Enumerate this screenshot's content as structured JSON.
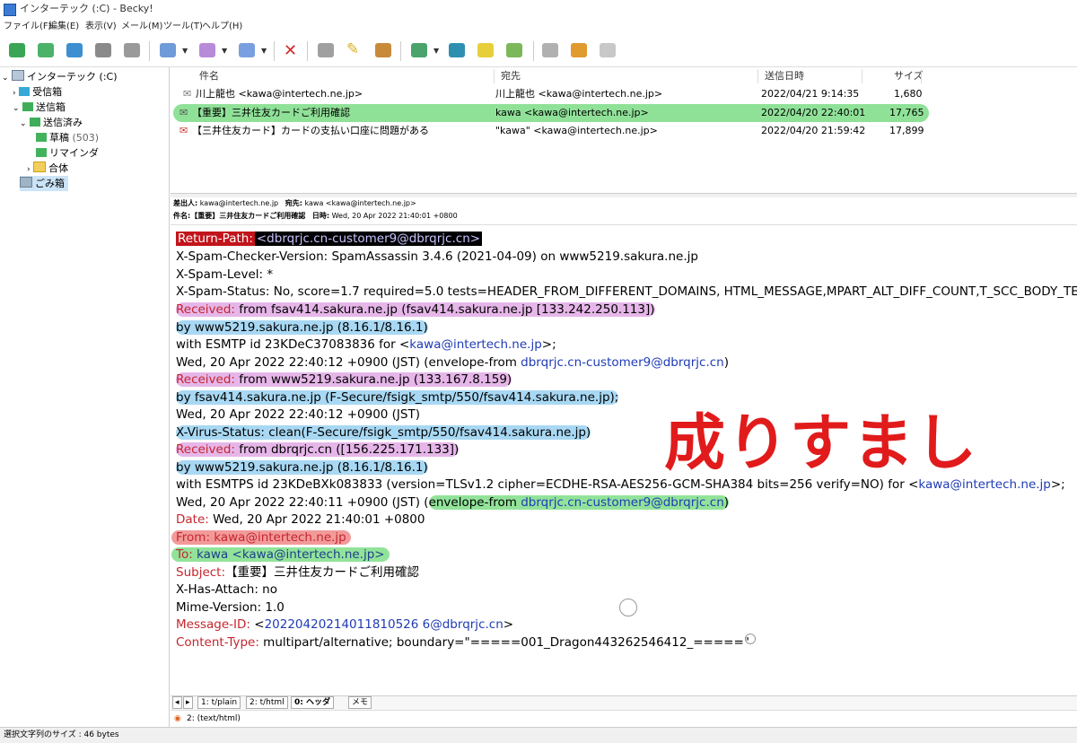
{
  "window": {
    "title": "インターテック (:C) - Becky!"
  },
  "menu": [
    "ファイル(F)",
    "編集(E)",
    "表示(V)",
    "メール(M)",
    "ツール(T)",
    "ヘルプ(H)"
  ],
  "tree": {
    "account": "インターテック (:C)",
    "inbox": "受信箱",
    "outbox": "送信箱",
    "sent": "送信済み",
    "drafts": "草稿",
    "drafts_count": "(503)",
    "reminder": "リマインダ",
    "merged": "合体",
    "trash": "ごみ箱"
  },
  "list": {
    "columns": [
      "件名",
      "宛先",
      "送信日時",
      "サイズ"
    ],
    "rows": [
      {
        "subject": "川上龍也 <kawa@intertech.ne.jp>",
        "to": "川上龍也 <kawa@intertech.ne.jp>",
        "date": "2022/04/21 9:14:35",
        "size": "1,680"
      },
      {
        "subject": "【重要】三井住友カードご利用確認",
        "to": "kawa <kawa@intertech.ne.jp>",
        "date": "2022/04/20 22:40:01",
        "size": "17,765"
      },
      {
        "subject": "【三井住友カード】カードの支払い口座に問題がある",
        "to": "\"kawa\" <kawa@intertech.ne.jp>",
        "date": "2022/04/20 21:59:42",
        "size": "17,899"
      }
    ]
  },
  "minihdr": {
    "from_label": "差出人:",
    "from": "kawa@intertech.ne.jp",
    "to_label": "宛先:",
    "to": "kawa <kawa@intertech.ne.jp>",
    "subject_label": "件名:",
    "subject": "【重要】三井住友カードご利用確認",
    "date_label": "日時:",
    "date": "Wed, 20 Apr 2022 21:40:01 +0800"
  },
  "headers": {
    "rp_key": "Return-Path:",
    "rp_val": "<dbrqrjc.cn-customer9@dbrqrjc.cn>",
    "l2": "X-Spam-Checker-Version: SpamAssassin 3.4.6 (2021-04-09) on www5219.sakura.ne.jp",
    "l3": "X-Spam-Level: *",
    "l4": "X-Spam-Status: No, score=1.7 required=5.0 tests=HEADER_FROM_DIFFERENT_DOMAINS, HTML_MESSAGE,MPART_ALT_DIFF_COUNT,T_SCC_BODY_TEXT_L",
    "recv_key": "Received:",
    "r1a": " from fsav414.sakura.ne.jp (fsav414.sakura.ne.jp [133.242.250.113])",
    "r1b": " by www5219.sakura.ne.jp (8.16.1/8.16.1)",
    "r1c_pre": " with ESMTP id 23KDeC37083836 for <",
    "r1c_link": "kawa@intertech.ne.jp",
    "r1c_post": ">;",
    "r1d_pre": " Wed, 20 Apr 2022 22:40:12 +0900 (JST) (envelope-from ",
    "r1d_link": "dbrqrjc.cn-customer9@dbrqrjc.cn",
    "r1d_post": ")",
    "r2a": " from www5219.sakura.ne.jp (133.167.8.159)",
    "r2b": " by fsav414.sakura.ne.jp (F-Secure/fsigk_smtp/550/fsav414.sakura.ne.jp);",
    "r2c": " Wed, 20 Apr 2022 22:40:12 +0900 (JST)",
    "xvirus": "X-Virus-Status: clean(F-Secure/fsigk_smtp/550/fsav414.sakura.ne.jp)",
    "r3a": " from dbrqrjc.cn ([156.225.171.133])",
    "r3b": " by www5219.sakura.ne.jp (8.16.1/8.16.1)",
    "r3c_pre": " with ESMTPS id 23KDeBXk083833 (version=TLSv1.2 cipher=ECDHE-RSA-AES256-GCM-SHA384 bits=256 verify=NO) for <",
    "r3c_link": "kawa@intertech.ne.jp",
    "r3c_post": ">;",
    "r3d_pre": " Wed, 20 Apr 2022 22:40:11 +0900 (JST) (",
    "r3d_env": "envelope-from ",
    "r3d_link": "dbrqrjc.cn-customer9@dbrqrjc.cn",
    "r3d_post": ")",
    "date_key": "Date:",
    "date_val": " Wed, 20 Apr 2022 21:40:01 +0800",
    "from_key": "From:",
    "from_val": " kawa@intertech.ne.jp",
    "to_key": "To:",
    "to_val": " kawa <kawa@intertech.ne.jp>",
    "subj_key": "Subject:",
    "subj_val": "【重要】三井住友カードご利用確認",
    "xattach": "X-Has-Attach: no",
    "mime": "Mime-Version: 1.0",
    "msgid_key": "Message-ID:",
    "msgid_pre": " <",
    "msgid_link": "20220420214011810526 6@dbrqrjc.cn",
    "msgid_post": ">",
    "ct_key": "Content-Type:",
    "ct_val": " multipart/alternative; boundary=\"=====001_Dragon443262546412_=====\""
  },
  "annotation": "成りすまし",
  "tabs": [
    "1: t/plain",
    "2: t/html",
    "0: ヘッダ",
    "メモ"
  ],
  "attachment": "2: (text/html)",
  "status": "選択文字列のサイズ : 46 bytes",
  "colors": {
    "accent_red": "#e11b1b",
    "highlight_green": "#7ddc86",
    "highlight_blue": "#a8d8f3",
    "highlight_pink": "#e6b6e9"
  }
}
